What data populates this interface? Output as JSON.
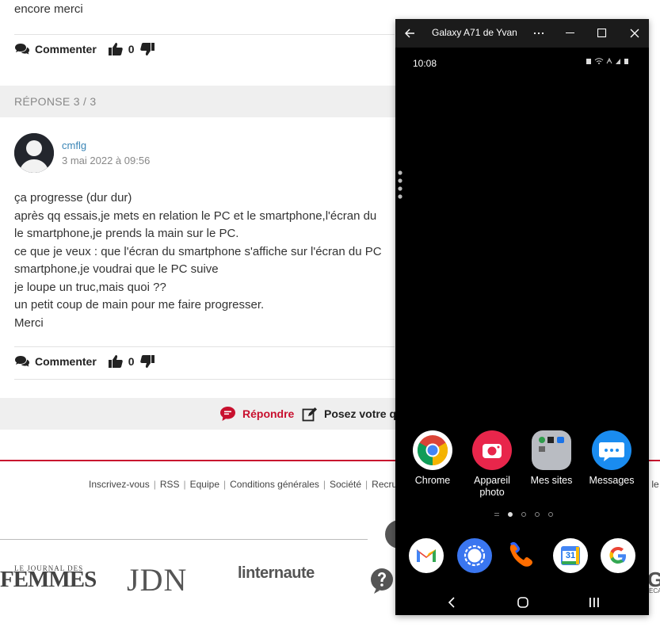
{
  "forum": {
    "previous_text": "encore merci",
    "comment_label": "Commenter",
    "vote_count_1": "0",
    "reply_header": "RÉPONSE 3 / 3",
    "author": "cmflg",
    "date": "3 mai 2022 à 09:56",
    "body_lines": [
      "ça progresse (dur dur)",
      "après qq essais,je mets en relation le PC et le smartphone,l'écran du",
      "le smartphone,je prends la main sur le PC.",
      "ce que je veux : que l'écran du smartphone s'affiche sur l'écran du PC",
      "smartphone,je voudrai que le PC suive",
      "je loupe un truc,mais quoi ??",
      "un petit coup de main pour me faire progresser.",
      "Merci"
    ],
    "comment_label_2": "Commenter",
    "vote_count_2": "0",
    "reply_button": "Répondre",
    "ask_button": "Posez votre qu"
  },
  "footer": {
    "links": [
      "Inscrivez-vous",
      "RSS",
      "Equipe",
      "Conditions générales",
      "Société",
      "Recru"
    ],
    "tail": "r le",
    "logos": {
      "femmes_top": "LE JOURNAL DES",
      "femmes_big": "FEMMES",
      "jdn": "JDN",
      "linternaute": "linternaute",
      "edge": "G",
      "edge_sub": "ECA"
    }
  },
  "phone": {
    "window_title": "Galaxy A71 de Yvan",
    "status_time": "10:08",
    "apps": [
      {
        "label": "Chrome",
        "icon": "chrome-icon"
      },
      {
        "label": "Appareil photo",
        "icon": "camera-icon"
      },
      {
        "label": "Mes sites",
        "icon": "folder-icon"
      },
      {
        "label": "Messages",
        "icon": "messages-icon"
      }
    ],
    "hotseat": [
      "gmail-icon",
      "signal-icon",
      "phone-icon",
      "calendar-icon",
      "google-icon"
    ],
    "calendar_day": "31"
  },
  "colors": {
    "accent_red": "#c8102e",
    "link_blue": "#3a85b6"
  }
}
